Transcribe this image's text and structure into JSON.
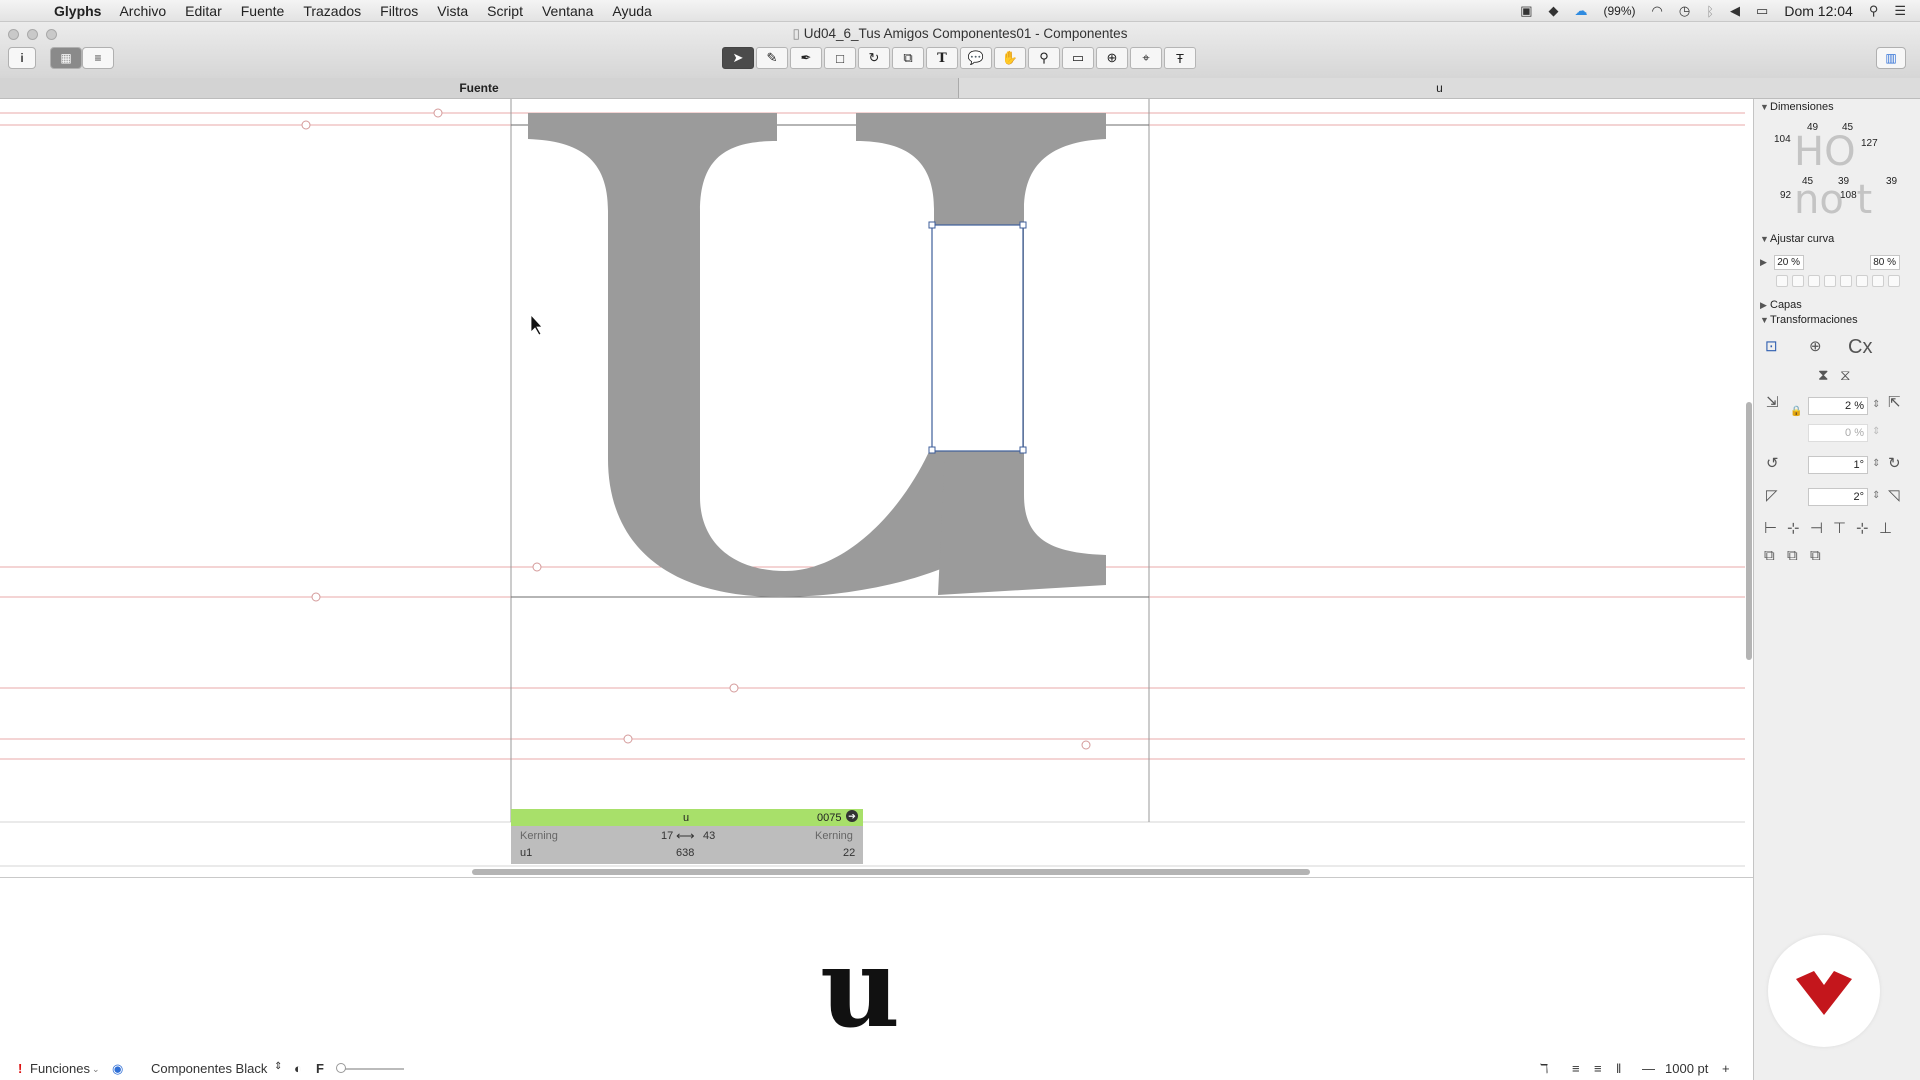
{
  "menubar": {
    "app": "Glyphs",
    "menus": [
      "Archivo",
      "Editar",
      "Fuente",
      "Trazados",
      "Filtros",
      "Vista",
      "Script",
      "Ventana",
      "Ayuda"
    ],
    "battery_percent": "(99%)",
    "clock": "Dom 12:04"
  },
  "window": {
    "title": "Ud04_6_Tus Amigos Componentes01 - Componentes"
  },
  "tabs": {
    "left": "Fuente",
    "right": "u"
  },
  "glyph_info": {
    "name": "u",
    "unicode": "0075",
    "left_kerning_label": "Kerning",
    "right_kerning_label": "Kerning",
    "lsb": "17",
    "rsb": "43",
    "component": "u1",
    "width": "638",
    "right_value": "22"
  },
  "preview": {
    "glyph": "u"
  },
  "bottombar": {
    "features_label": "Funciones",
    "instance": "Componentes Black",
    "f_label": "F",
    "size": "1000 pt"
  },
  "panel": {
    "dimensiones": {
      "title": "Dimensiones",
      "sample_top": "HO",
      "sample_bottom": "no t",
      "values": [
        "104",
        "49",
        "45",
        "127",
        "92",
        "45",
        "39",
        "108",
        "39"
      ]
    },
    "ajustar_curva": {
      "title": "Ajustar curva",
      "min": "20 %",
      "max": "80 %"
    },
    "capas": {
      "title": "Capas"
    },
    "transformaciones": {
      "title": "Transformaciones",
      "scale": "2 %",
      "scale_y": "0 %",
      "rotate": "1°",
      "slant": "2°",
      "cx_label": "Cx"
    }
  },
  "colors": {
    "guide_red": "#e8a9a9",
    "glyph_fill": "#9b9b9b",
    "info_green": "#a8e06a",
    "logo_red": "#c4161c"
  }
}
